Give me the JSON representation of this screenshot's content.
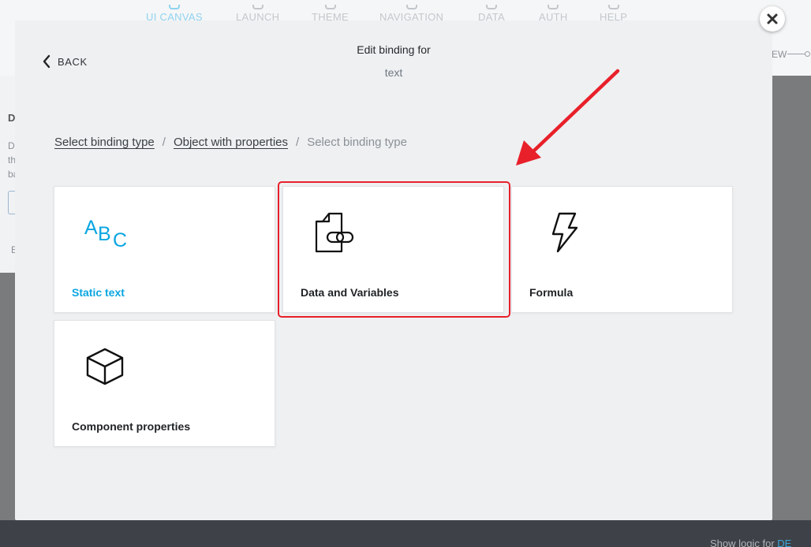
{
  "background": {
    "tabs": [
      "UI CANVAS",
      "LAUNCH",
      "THEME",
      "NAVIGATION",
      "DATA",
      "AUTH",
      "HELP"
    ],
    "right_label": "EW",
    "footer_logic_label": "Show logic for",
    "footer_logic_value": "DE"
  },
  "modal": {
    "back_label": "BACK",
    "title": "Edit binding for",
    "subtitle": "text",
    "breadcrumb": {
      "item1": "Select binding type",
      "item2": "Object with properties",
      "current": "Select binding type",
      "separator": "/"
    },
    "cards": {
      "static_text": {
        "label": "Static text",
        "icon": "abc-text-icon"
      },
      "data_variables": {
        "label": "Data and Variables",
        "icon": "linked-document-icon"
      },
      "formula": {
        "label": "Formula",
        "icon": "lightning-bolt-icon"
      },
      "component_properties": {
        "label": "Component properties",
        "icon": "cube-icon"
      }
    }
  },
  "annotation": {
    "highlight_color": "#e8202a",
    "target": "data-and-variables-card"
  },
  "colors": {
    "accent": "#0ba6e2",
    "modal_bg": "#eff0f2",
    "overlay": "#7a7b7d"
  }
}
